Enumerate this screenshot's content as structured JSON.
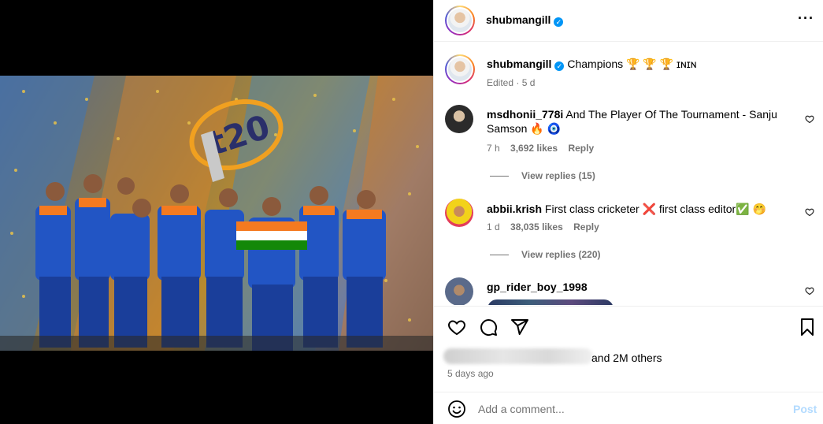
{
  "post": {
    "username": "shubmangill",
    "verified": true,
    "more_icon": "more-horizontal-icon"
  },
  "caption": {
    "username": "shubmangill",
    "text": "Champions 🏆 🏆 🏆 ɪɴɪɴ",
    "edited": "Edited · 5 d"
  },
  "comments": [
    {
      "username": "msdhonii_778i",
      "text": "And The Player Of The Tournament - Sanju",
      "text2": "Samson 🔥 🧿",
      "time": "7 h",
      "likes": "3,692 likes",
      "reply": "Reply",
      "view_replies": "View replies (15)"
    },
    {
      "username": "abbii.krish",
      "text": "First class cricketer ❌ first class editor✅ 🤭",
      "time": "1 d",
      "likes": "38,035 likes",
      "reply": "Reply",
      "view_replies": "View replies (220)"
    },
    {
      "username": "gp_rider_boy_1998"
    }
  ],
  "actions": {
    "icons": [
      "heart-icon",
      "comment-icon",
      "share-icon",
      "bookmark-icon"
    ],
    "likes_suffix": "and 2M others",
    "posted": "5 days ago"
  },
  "composer": {
    "placeholder": "Add a comment...",
    "post_label": "Post",
    "emoji_icon": "emoji-icon"
  },
  "colors": {
    "link_blue": "#0095f6",
    "post_disabled": "#b3dbff",
    "secondary_text": "#737373"
  }
}
